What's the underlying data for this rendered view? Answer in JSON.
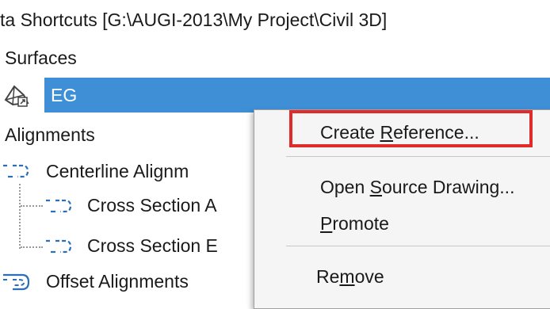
{
  "window": {
    "title": "ta Shortcuts [G:\\AUGI-2013\\My Project\\Civil 3D]"
  },
  "tree": {
    "surfaces_label": "Surfaces",
    "surface_item": "EG",
    "alignments_label": "Alignments",
    "centerline_label": "Centerline Alignm",
    "cross_section_a_label": "Cross Section A",
    "cross_section_b_label": "Cross Section E",
    "offset_label": "Offset Alignments"
  },
  "context_menu": {
    "create_reference_pre": "Create ",
    "create_reference_u": "R",
    "create_reference_post": "eference...",
    "open_source_pre": "Open ",
    "open_source_u": "S",
    "open_source_post": "ource Drawing...",
    "promote_u": "P",
    "promote_post": "romote",
    "remove_pre": "Re",
    "remove_u": "m",
    "remove_post": "ove"
  },
  "colors": {
    "selection": "#3f8fd6",
    "highlight_box": "#e02b2b"
  },
  "icons": {
    "surface": "surface-icon",
    "alignment": "alignment-icon",
    "offset_alignment": "offset-alignment-icon"
  }
}
